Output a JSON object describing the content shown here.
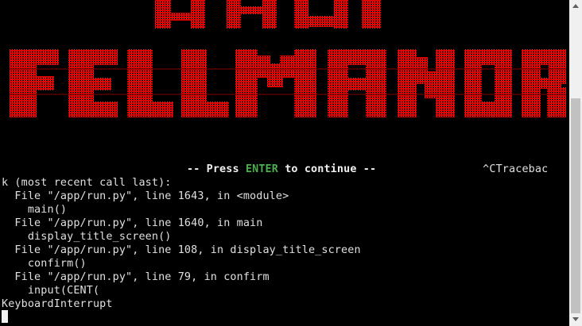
{
  "terminal": {
    "banner": {
      "top_word_partial": "TALE",
      "main_word": "FELL MANOR",
      "color": "#dd0000"
    },
    "prompt": {
      "before": "-- Press ",
      "highlight": "ENTER",
      "after": " to continue --",
      "interrupt": "^CTracebac",
      "highlight_color": "#4caf50"
    },
    "traceback": [
      "k (most recent call last):",
      "  File \"/app/run.py\", line 1643, in <module>",
      "    main()",
      "  File \"/app/run.py\", line 1640, in main",
      "    display_title_screen()",
      "  File \"/app/run.py\", line 108, in display_title_screen",
      "    confirm()",
      "  File \"/app/run.py\", line 79, in confirm",
      "    input(CENT(",
      "KeyboardInterrupt"
    ],
    "colors": {
      "background": "#000000",
      "text": "#e0e0e0"
    }
  },
  "scrollbar": {
    "up_icon": "triangle-up",
    "down_icon": "triangle-down",
    "position": 0.95
  }
}
